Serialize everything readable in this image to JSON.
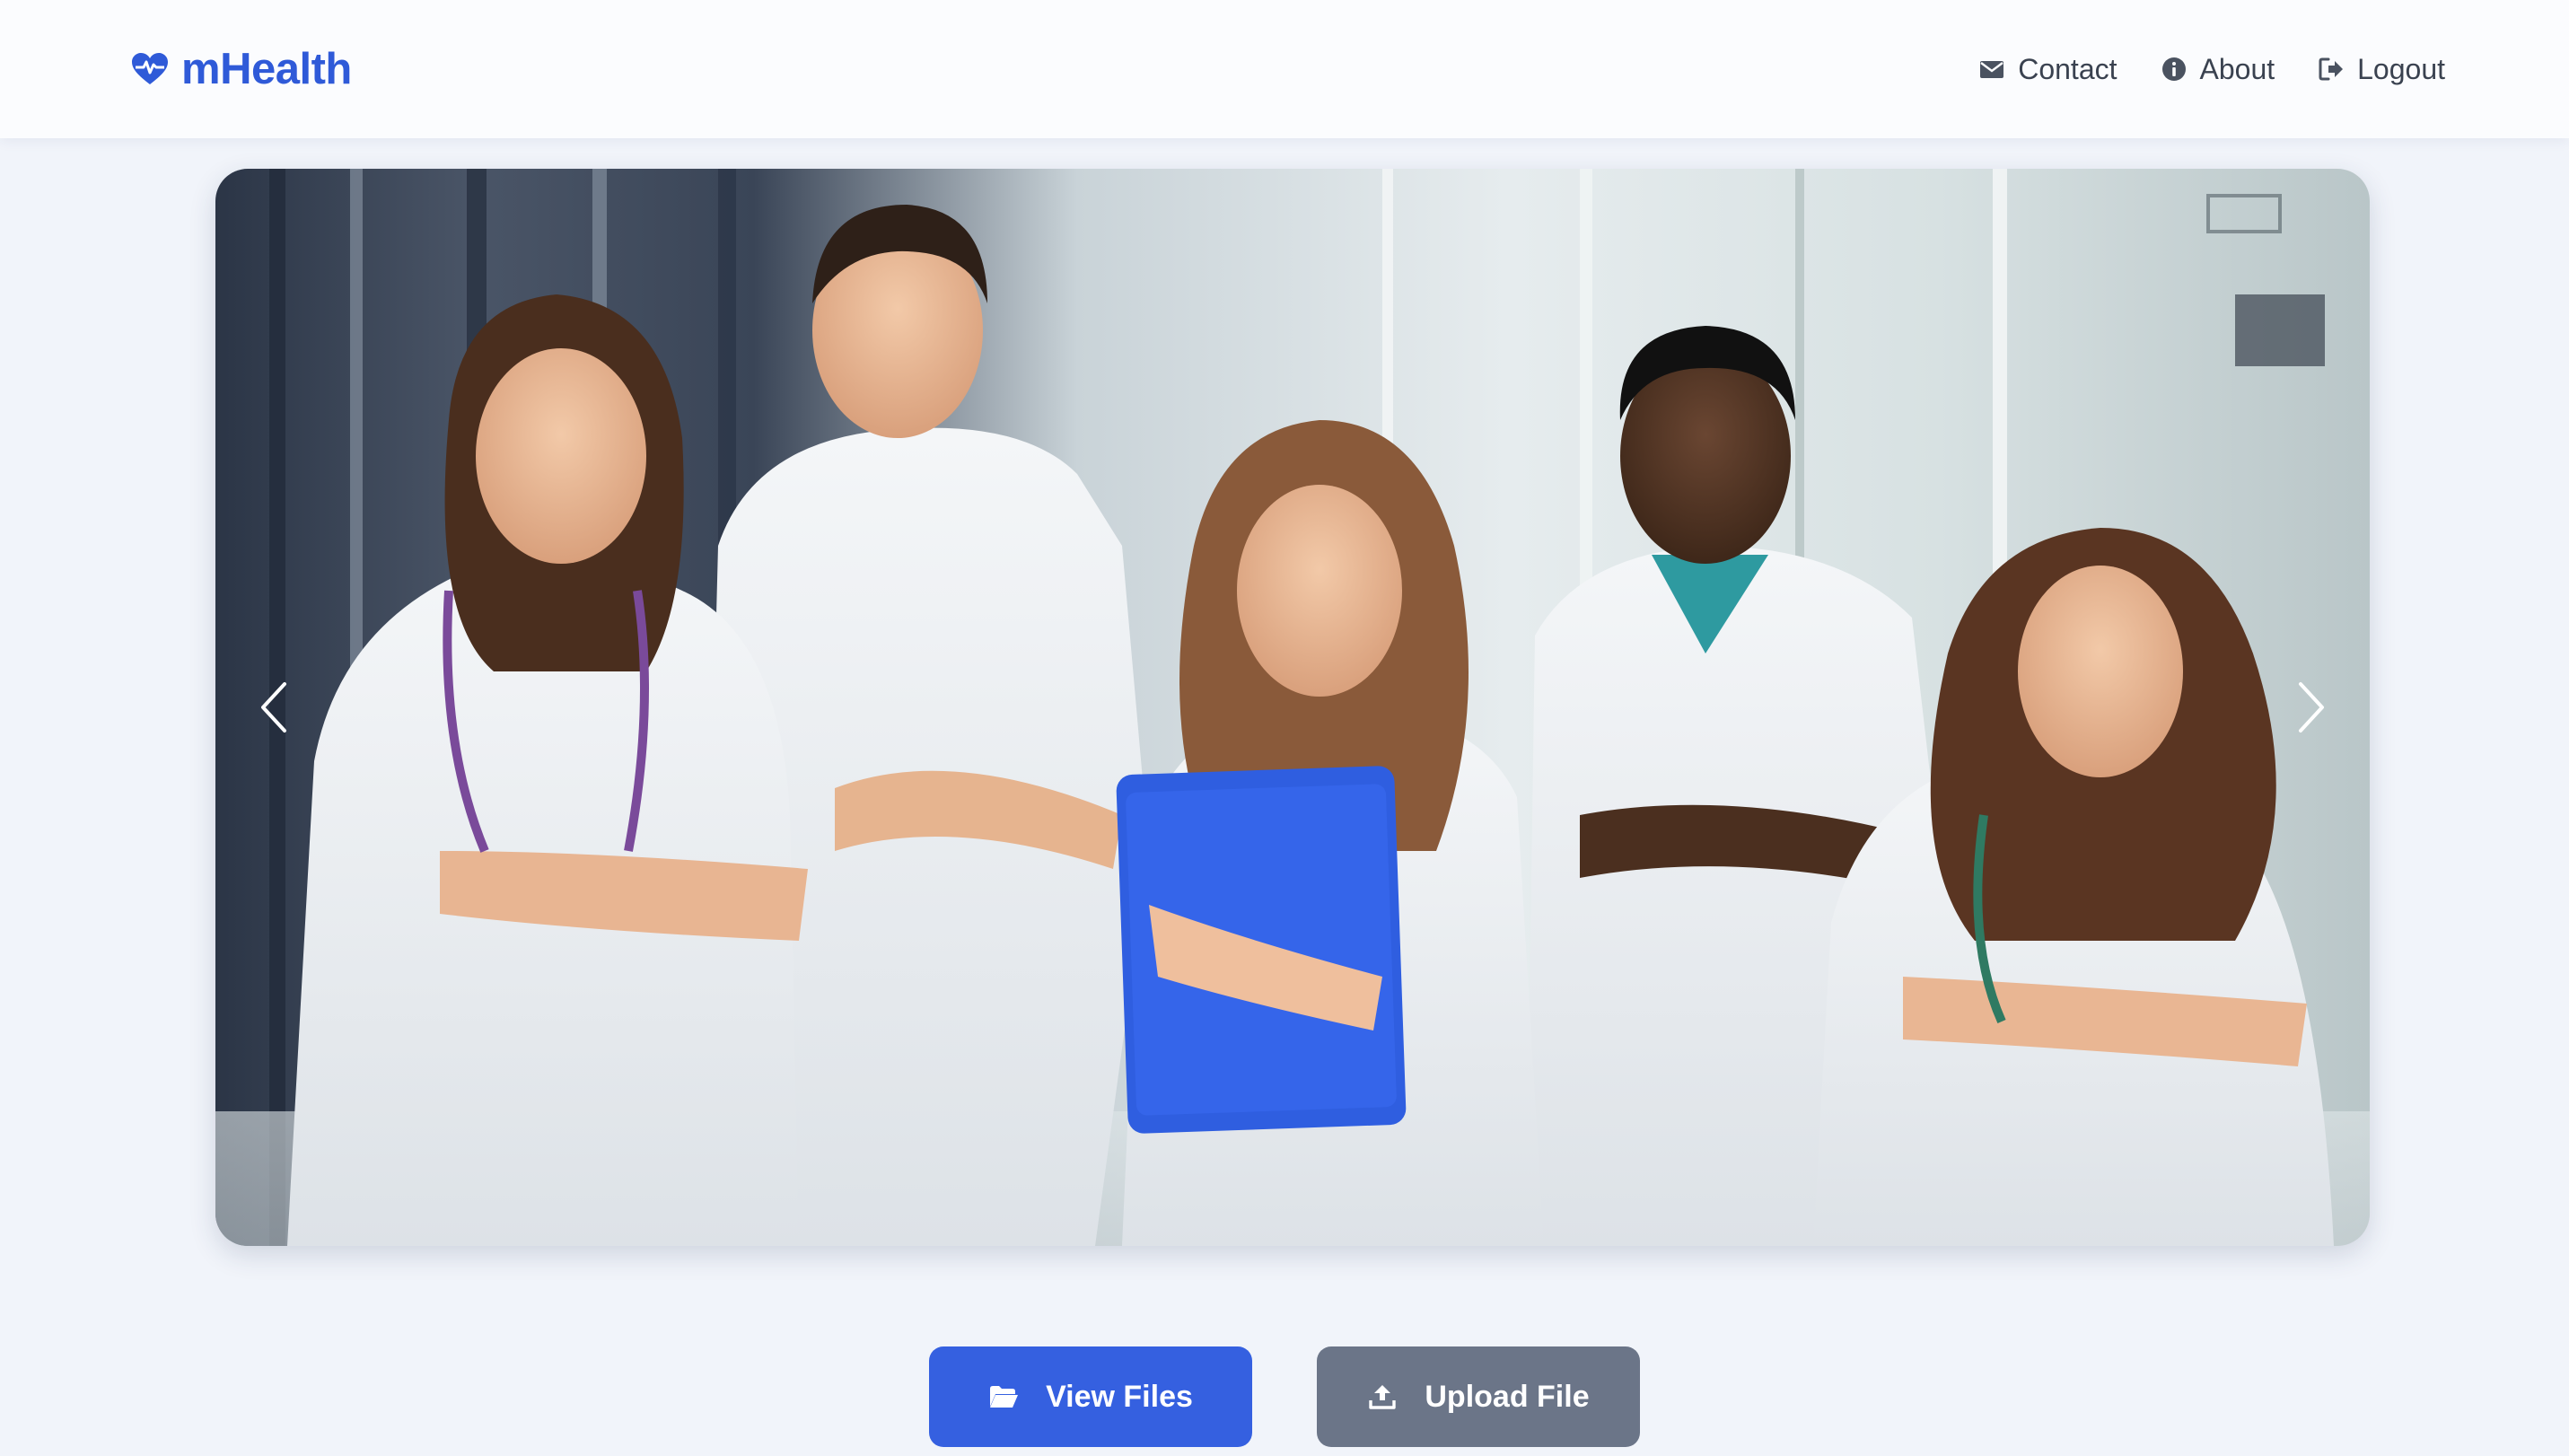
{
  "brand": {
    "name": "mHealth",
    "icon": "heart-pulse-icon",
    "color": "#2f5ad8"
  },
  "nav": {
    "items": [
      {
        "label": "Contact",
        "icon": "envelope-icon"
      },
      {
        "label": "About",
        "icon": "info-circle-icon"
      },
      {
        "label": "Logout",
        "icon": "logout-icon"
      }
    ]
  },
  "carousel": {
    "image_alt": "medical-team-photo",
    "prev_icon": "chevron-left-icon",
    "next_icon": "chevron-right-icon"
  },
  "actions": {
    "view_files": {
      "label": "View Files",
      "icon": "folder-open-icon",
      "color": "#3560e0"
    },
    "upload_file": {
      "label": "Upload File",
      "icon": "upload-icon",
      "color": "#6b7588"
    }
  }
}
